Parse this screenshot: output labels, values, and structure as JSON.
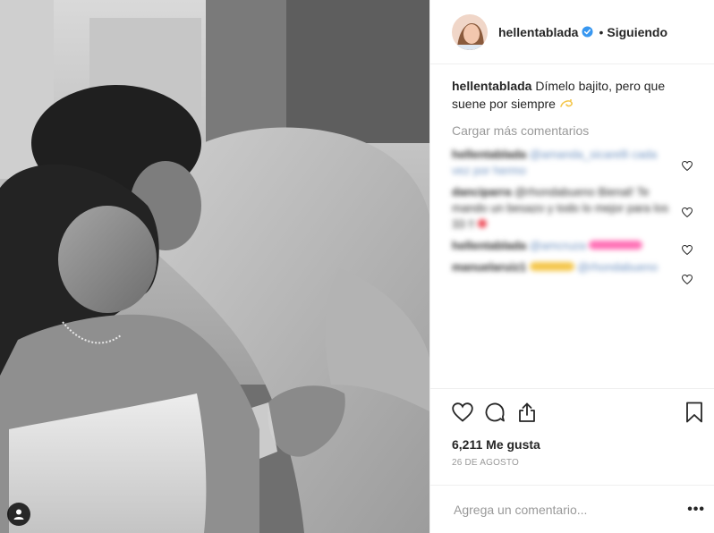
{
  "header": {
    "username": "hellentablada",
    "separator": "•",
    "follow_status": "Siguiendo"
  },
  "caption": {
    "username": "hellentablada",
    "text": "Dímelo bajito, pero que suene por siempre",
    "emoji_icon": "dizzy-icon"
  },
  "load_more": "Cargar más comentarios",
  "comments": [
    {
      "author": "hellentablada",
      "text": "@amanda_sicarelli cada vez por hermo"
    },
    {
      "author": "danciparra",
      "text": "@rhondabueno Bienal! Te mando un besazo y todo lo mejor para los 33 !!"
    },
    {
      "author": "hellentablada",
      "text": "@amcruza"
    },
    {
      "author": "manuelaruiz1",
      "text": "@rhondabueno"
    }
  ],
  "likes": "6,211 Me gusta",
  "date": "26 de agosto",
  "add_comment": {
    "placeholder": "Agrega un comentario...",
    "more": "•••"
  },
  "colors": {
    "verified": "#3897f0",
    "text": "#262626",
    "muted": "#999999",
    "border": "#efefef",
    "heart_emoji": "#ed4956",
    "pink_hearts": "#ff6fb5",
    "emoji_yellow": "#f4c64a"
  }
}
